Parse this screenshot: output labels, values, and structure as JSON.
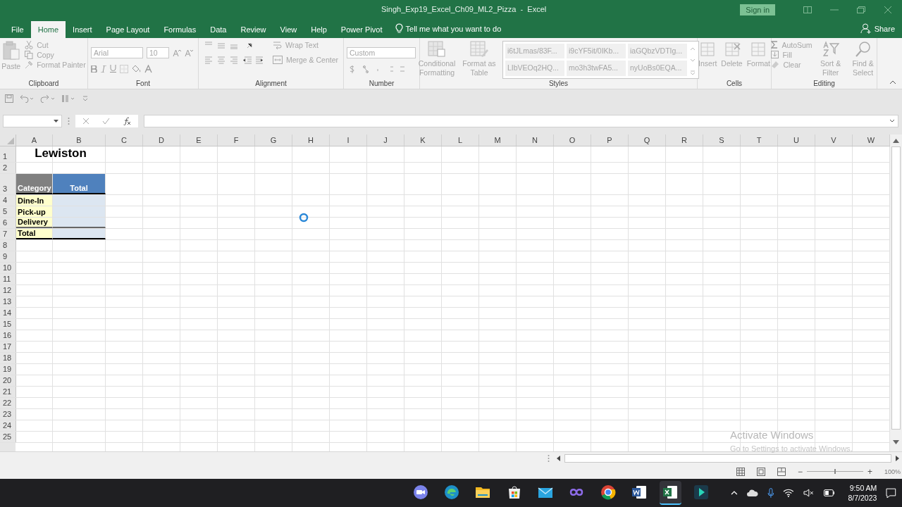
{
  "window": {
    "title": "Singh_Exp19_Excel_Ch09_ML2_Pizza  -  Excel",
    "sign_in": "Sign in"
  },
  "tabs": [
    {
      "label": "File",
      "selected": false
    },
    {
      "label": "Home",
      "selected": true
    },
    {
      "label": "Insert",
      "selected": false
    },
    {
      "label": "Page Layout",
      "selected": false
    },
    {
      "label": "Formulas",
      "selected": false
    },
    {
      "label": "Data",
      "selected": false
    },
    {
      "label": "Review",
      "selected": false
    },
    {
      "label": "View",
      "selected": false
    },
    {
      "label": "Help",
      "selected": false
    },
    {
      "label": "Power Pivot",
      "selected": false
    }
  ],
  "tell_me": "Tell me what you want to do",
  "share": "Share",
  "ribbon": {
    "disabled": true,
    "clipboard": {
      "label": "Clipboard",
      "paste": "Paste",
      "cut": "Cut",
      "copy": "Copy",
      "format_painter": "Format Painter"
    },
    "font": {
      "label": "Font",
      "font_name": "Arial",
      "font_size": "10"
    },
    "alignment": {
      "label": "Alignment",
      "wrap_text": "Wrap Text",
      "merge_center": "Merge & Center"
    },
    "number": {
      "label": "Number",
      "format": "Custom"
    },
    "styles": {
      "label": "Styles",
      "conditional_formatting": "Conditional Formatting",
      "format_as_table": "Format as Table",
      "cell_styles": [
        "i6tJLmas/83F...",
        "i9cYF5it/0IKb...",
        "iaGQbzVDTIg...",
        "LIbVEOq2HQ...",
        "mo3h3twFA5...",
        "nyUoBs0EQA..."
      ]
    },
    "cells": {
      "label": "Cells",
      "buttons": [
        "Insert",
        "Delete",
        "Format"
      ]
    },
    "editing": {
      "label": "Editing",
      "autosum": "AutoSum",
      "fill": "Fill",
      "clear": "Clear",
      "sort_filter": "Sort & Filter",
      "find_select": "Find & Select"
    }
  },
  "sheet": {
    "columns": [
      "A",
      "B",
      "C",
      "D",
      "E",
      "F",
      "G",
      "H",
      "I",
      "J",
      "K",
      "L",
      "M",
      "N",
      "O",
      "P",
      "Q",
      "R",
      "S",
      "T",
      "U",
      "V",
      "W"
    ],
    "rows": [
      {
        "label": "1",
        "kind": "title",
        "a": "Lewiston"
      },
      {
        "label": "2"
      },
      {
        "label": "3",
        "kind": "header",
        "a": "Category",
        "b": "Total"
      },
      {
        "label": "4",
        "kind": "item",
        "a": "Dine-In"
      },
      {
        "label": "5",
        "kind": "item",
        "a": "Pick-up"
      },
      {
        "label": "6",
        "kind": "item",
        "a": "Delivery"
      },
      {
        "label": "7",
        "kind": "total",
        "a": "Total"
      },
      {
        "label": "8"
      },
      {
        "label": "9"
      },
      {
        "label": "10"
      },
      {
        "label": "11"
      },
      {
        "label": "12"
      },
      {
        "label": "13"
      },
      {
        "label": "14"
      },
      {
        "label": "15"
      },
      {
        "label": "16"
      },
      {
        "label": "17"
      },
      {
        "label": "18"
      },
      {
        "label": "19"
      },
      {
        "label": "20"
      },
      {
        "label": "21"
      },
      {
        "label": "22"
      },
      {
        "label": "23"
      },
      {
        "label": "24"
      },
      {
        "label": "25"
      }
    ]
  },
  "activation": {
    "title": "Activate Windows",
    "hint": "Go to Settings to activate Windows."
  },
  "status_bar": {
    "zoom_out": "−",
    "level": 0.5,
    "zoom_in": "+",
    "zoom": "100%"
  },
  "taskbar": {
    "time": "9:50 AM",
    "date": "8/7/2023"
  }
}
